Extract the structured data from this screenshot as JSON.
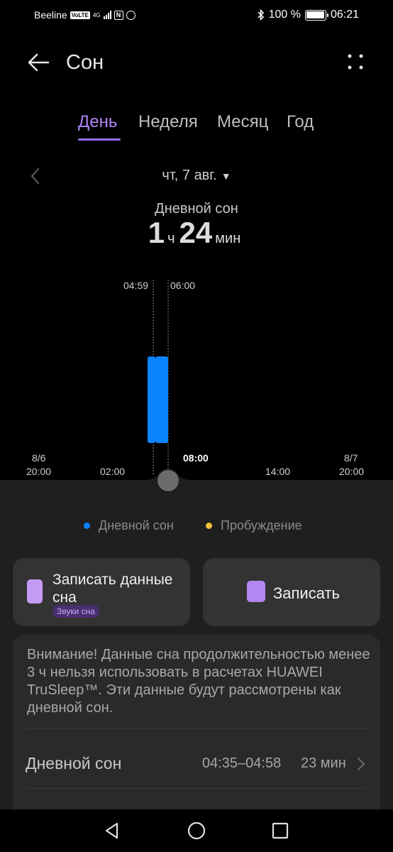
{
  "status_bar": {
    "carrier": "Beeline",
    "volte": "VoLTE",
    "network": "4G",
    "battery": "100 %",
    "time": "06:21"
  },
  "app_bar": {
    "title": "Сон"
  },
  "tabs": [
    {
      "label": "День",
      "active": true
    },
    {
      "label": "Неделя",
      "active": false
    },
    {
      "label": "Месяц",
      "active": false
    },
    {
      "label": "Год",
      "active": false
    }
  ],
  "date": {
    "label": "чт, 7 авг."
  },
  "summary": {
    "label": "Дневной сон",
    "hours": "1",
    "hours_unit": "ч",
    "minutes": "24",
    "minutes_unit": "мин"
  },
  "chart": {
    "range_start": "04:59",
    "range_end": "06:00",
    "x_labels": [
      {
        "top": "8/6",
        "bottom": "20:00"
      },
      {
        "top": "",
        "bottom": "02:00"
      },
      {
        "top": "",
        "bottom": "08:00"
      },
      {
        "top": "",
        "bottom": "14:00"
      },
      {
        "top": "8/7",
        "bottom": "20:00"
      }
    ],
    "bar_color": "#0a84ff"
  },
  "chart_data": {
    "type": "bar",
    "series": [
      {
        "name": "Дневной сон",
        "segments": [
          {
            "start": "04:35",
            "end": "04:58"
          },
          {
            "start": "04:59",
            "end": "06:00"
          }
        ]
      }
    ]
  },
  "legend": [
    {
      "label": "Дневной сон",
      "color": "#0a84ff"
    },
    {
      "label": "Пробуждение",
      "color": "#f5c13c"
    }
  ],
  "actions": {
    "record_sleep_label": "Записать данные сна",
    "record_sleep_badge": "Звуки сна",
    "record_label": "Записать"
  },
  "info": {
    "warning": "Внимание! Данные сна продолжительностью менее 3 ч нельзя использовать в расчетах HUAWEI TruSleep™. Эти данные будут рассмотрены как дневной сон.",
    "entries": [
      {
        "label": "Дневной сон",
        "time": "04:35–04:58",
        "duration": "23 мин"
      }
    ]
  }
}
